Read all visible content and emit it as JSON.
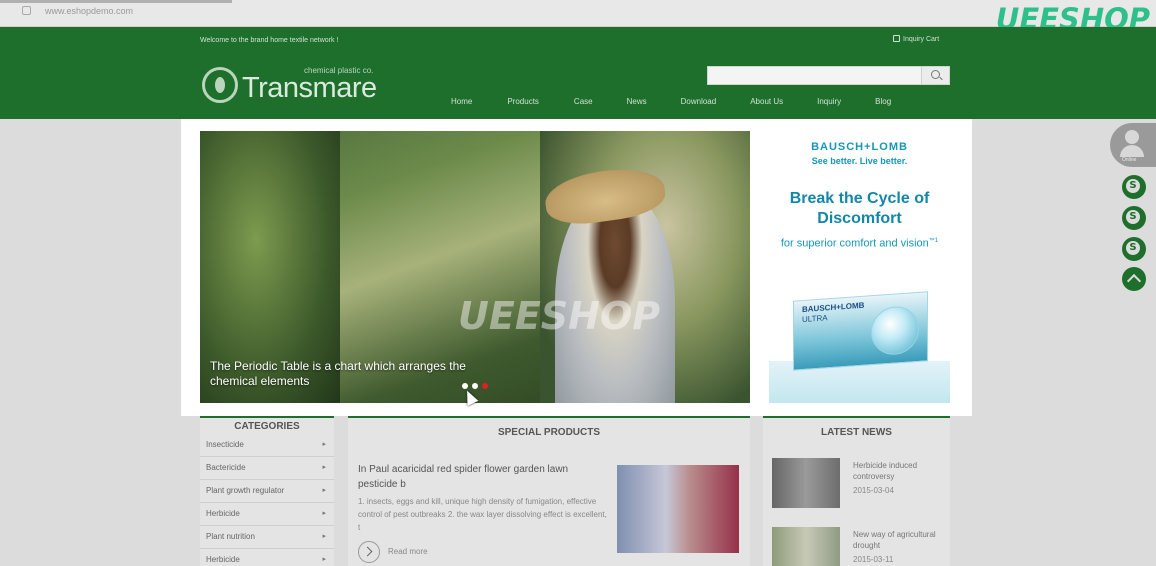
{
  "browser": {
    "url": "www.eshopdemo.com"
  },
  "watermark": "UEESHOP",
  "header": {
    "welcome": "Welcome to the brand home textile network !",
    "inquiry_cart": "Inquiry Cart",
    "logo_name": "Transmare",
    "logo_tagline": "chemical plastic co.",
    "search_placeholder": "",
    "nav": [
      "Home",
      "Products",
      "Case",
      "News",
      "Download",
      "About Us",
      "Inquiry",
      "Blog"
    ]
  },
  "slider": {
    "caption": "The Periodic Table is a chart which arranges the chemical elements",
    "watermark": "UEESHOP",
    "dots_total": 3,
    "active_dot": 3
  },
  "ad": {
    "brand": "BAUSCH+LOMB",
    "slogan": "See better. Live better.",
    "headline": "Break the Cycle of Discomfort",
    "sub": "for superior comfort and vision",
    "sub_mark": "™1",
    "product_brand": "BAUSCH+LOMB",
    "product_name": "ULTRA"
  },
  "side": {
    "avatar_label": "Online"
  },
  "categories": {
    "title": "CATEGORIES",
    "items": [
      "Insecticide",
      "Bactericide",
      "Plant growth regulator",
      "Herbicide",
      "Plant nutrition",
      "Herbicide"
    ]
  },
  "special": {
    "title": "SPECIAL PRODUCTS",
    "product_title": "In Paul acaricidal red spider flower garden lawn pesticide b",
    "product_desc": "1. insects, eggs and kill, unique high density of fumigation, effective control of pest outbreaks  2. the wax layer dissolving effect is excellent, t",
    "read_more": "Read more"
  },
  "news": {
    "title": "LATEST NEWS",
    "items": [
      {
        "title": "Herbicide induced controversy",
        "date": "2015-03-04"
      },
      {
        "title": "New way of agricultural drought",
        "date": "2015-03-11"
      }
    ]
  },
  "colors": {
    "brand_green": "#1e6e2c",
    "watermark": "#2ec08a",
    "ad_blue": "#1597b8",
    "active_dot": "#e02020"
  }
}
